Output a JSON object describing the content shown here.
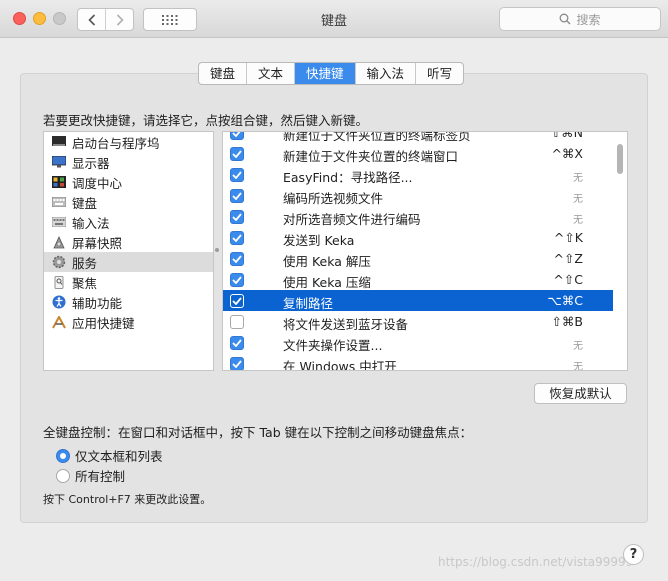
{
  "window": {
    "title": "键盘"
  },
  "search": {
    "placeholder": "搜索"
  },
  "tabs": [
    {
      "label": "键盘",
      "active": false
    },
    {
      "label": "文本",
      "active": false
    },
    {
      "label": "快捷键",
      "active": true
    },
    {
      "label": "输入法",
      "active": false
    },
    {
      "label": "听写",
      "active": false
    }
  ],
  "instruction": "若要更改快捷键，请选择它，点按组合键，然后键入新键。",
  "categories": [
    {
      "label": "启动台与程序坞",
      "icon": "launchpad-icon"
    },
    {
      "label": "显示器",
      "icon": "display-icon"
    },
    {
      "label": "调度中心",
      "icon": "mission-control-icon"
    },
    {
      "label": "键盘",
      "icon": "keyboard-icon"
    },
    {
      "label": "输入法",
      "icon": "input-method-icon"
    },
    {
      "label": "屏幕快照",
      "icon": "screenshot-icon"
    },
    {
      "label": "服务",
      "icon": "gear-icon",
      "selected": true
    },
    {
      "label": "聚焦",
      "icon": "spotlight-icon"
    },
    {
      "label": "辅助功能",
      "icon": "accessibility-icon"
    },
    {
      "label": "应用快捷键",
      "icon": "app-shortcuts-icon"
    }
  ],
  "shortcuts": [
    {
      "label": "新建位于文件夹位置的终端标签页",
      "key": "⇧⌘N",
      "checked": true
    },
    {
      "label": "新建位于文件夹位置的终端窗口",
      "key": "^⌘X",
      "checked": true
    },
    {
      "label": "EasyFind：寻找路径...",
      "key": "无",
      "checked": true,
      "none": true
    },
    {
      "label": "编码所选视频文件",
      "key": "无",
      "checked": true,
      "none": true
    },
    {
      "label": "对所选音频文件进行编码",
      "key": "无",
      "checked": true,
      "none": true
    },
    {
      "label": "发送到 Keka",
      "key": "^⇧K",
      "checked": true
    },
    {
      "label": "使用 Keka 解压",
      "key": "^⇧Z",
      "checked": true
    },
    {
      "label": "使用 Keka 压缩",
      "key": "^⇧C",
      "checked": true
    },
    {
      "label": "复制路径",
      "key": "⌥⌘C",
      "checked": true,
      "selected": true
    },
    {
      "label": "将文件发送到蓝牙设备",
      "key": "⇧⌘B",
      "checked": false
    },
    {
      "label": "文件夹操作设置...",
      "key": "无",
      "checked": true,
      "none": true
    },
    {
      "label": "在 Windows 中打开",
      "key": "无",
      "checked": true,
      "none": true
    }
  ],
  "restore_button": "恢复成默认",
  "full_keyboard": {
    "title": "全键盘控制：在窗口和对话框中，按下 Tab 键在以下控制之间移动键盘焦点：",
    "option_text_only": "仅文本框和列表",
    "option_all": "所有控制",
    "selected": "text_only",
    "hint": "按下 Control+F7 来更改此设置。"
  },
  "help_label": "?",
  "watermark": "https://blog.csdn.net/vista99999",
  "colors": {
    "accent": "#3b8bec",
    "selection": "#0b63d2"
  }
}
